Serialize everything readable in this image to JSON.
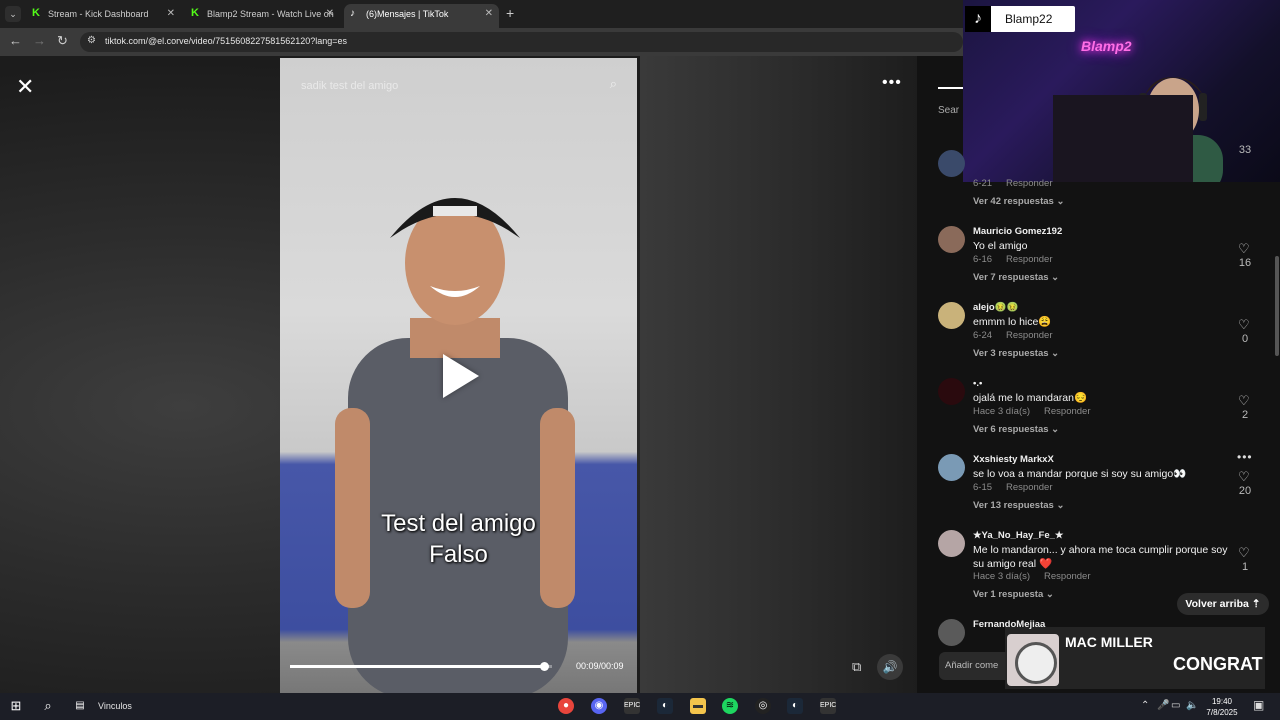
{
  "browser": {
    "tabs": [
      {
        "label": "Stream - Kick Dashboard",
        "color": "#53fc18"
      },
      {
        "label": "Blamp2 Stream - Watch Live on",
        "color": "#53fc18"
      },
      {
        "label": "(6)Mensajes | TikTok",
        "color": "#ffffff",
        "active": true
      }
    ],
    "url": "tiktok.com/@el.corve/video/7515608227581562120?lang=es"
  },
  "video": {
    "search_text": "sadik test del amigo",
    "caption_line1": "Test del amigo",
    "caption_line2": "Falso",
    "time": "00:09/00:09",
    "progress": 0.97
  },
  "side": {
    "search_label": "Sear",
    "back_to_top": "Volver arriba",
    "add_comment": "Añadir come"
  },
  "comments": [
    {
      "user": "",
      "text": "",
      "date": "6-21",
      "reply": "Responder",
      "likes": "33",
      "replies": "Ver 42 respuestas",
      "avatar": "#3a4a6a"
    },
    {
      "user": "Mauricio Gomez192",
      "text": "Yo el amigo",
      "date": "6-16",
      "reply": "Responder",
      "likes": "16",
      "replies": "Ver 7 respuestas",
      "avatar": "#8a6a5a"
    },
    {
      "user": "alejo🤢🤢",
      "text": "emmm lo hice😩",
      "date": "6-24",
      "reply": "Responder",
      "likes": "0",
      "replies": "Ver 3 respuestas",
      "avatar": "#c9b27a"
    },
    {
      "user": "•.•",
      "text": "ojalá me lo mandaran😔",
      "date": "Hace 3 día(s)",
      "reply": "Responder",
      "likes": "2",
      "replies": "Ver 6 respuestas",
      "avatar": "#2a0a0e"
    },
    {
      "user": "Xxshiesty MarkxX",
      "text": "se lo voa a mandar porque si soy su amigo👀",
      "date": "6-15",
      "reply": "Responder",
      "likes": "20",
      "replies": "Ver 13 respuestas",
      "avatar": "#7a9ab5"
    },
    {
      "user": "★Ya_No_Hay_Fe_★",
      "text": "Me lo mandaron... y ahora me toca cumplir porque soy su amigo real ❤️",
      "date": "Hace 3 día(s)",
      "reply": "Responder",
      "likes": "1",
      "replies": "Ver 1 respuesta",
      "avatar": "#b5a5a5"
    },
    {
      "user": "FernandoMejiaa",
      "text": "",
      "date": "",
      "reply": "",
      "likes": "",
      "replies": "",
      "avatar": "#5a5a5a"
    }
  ],
  "overlay": {
    "cam_name": "Blamp22",
    "neon_text": "Blamp2",
    "artist": "MAC MILLER",
    "song": "CONGRAT"
  },
  "taskbar": {
    "label": "Vinculos",
    "time": "19:40",
    "date": "7/8/2025"
  }
}
